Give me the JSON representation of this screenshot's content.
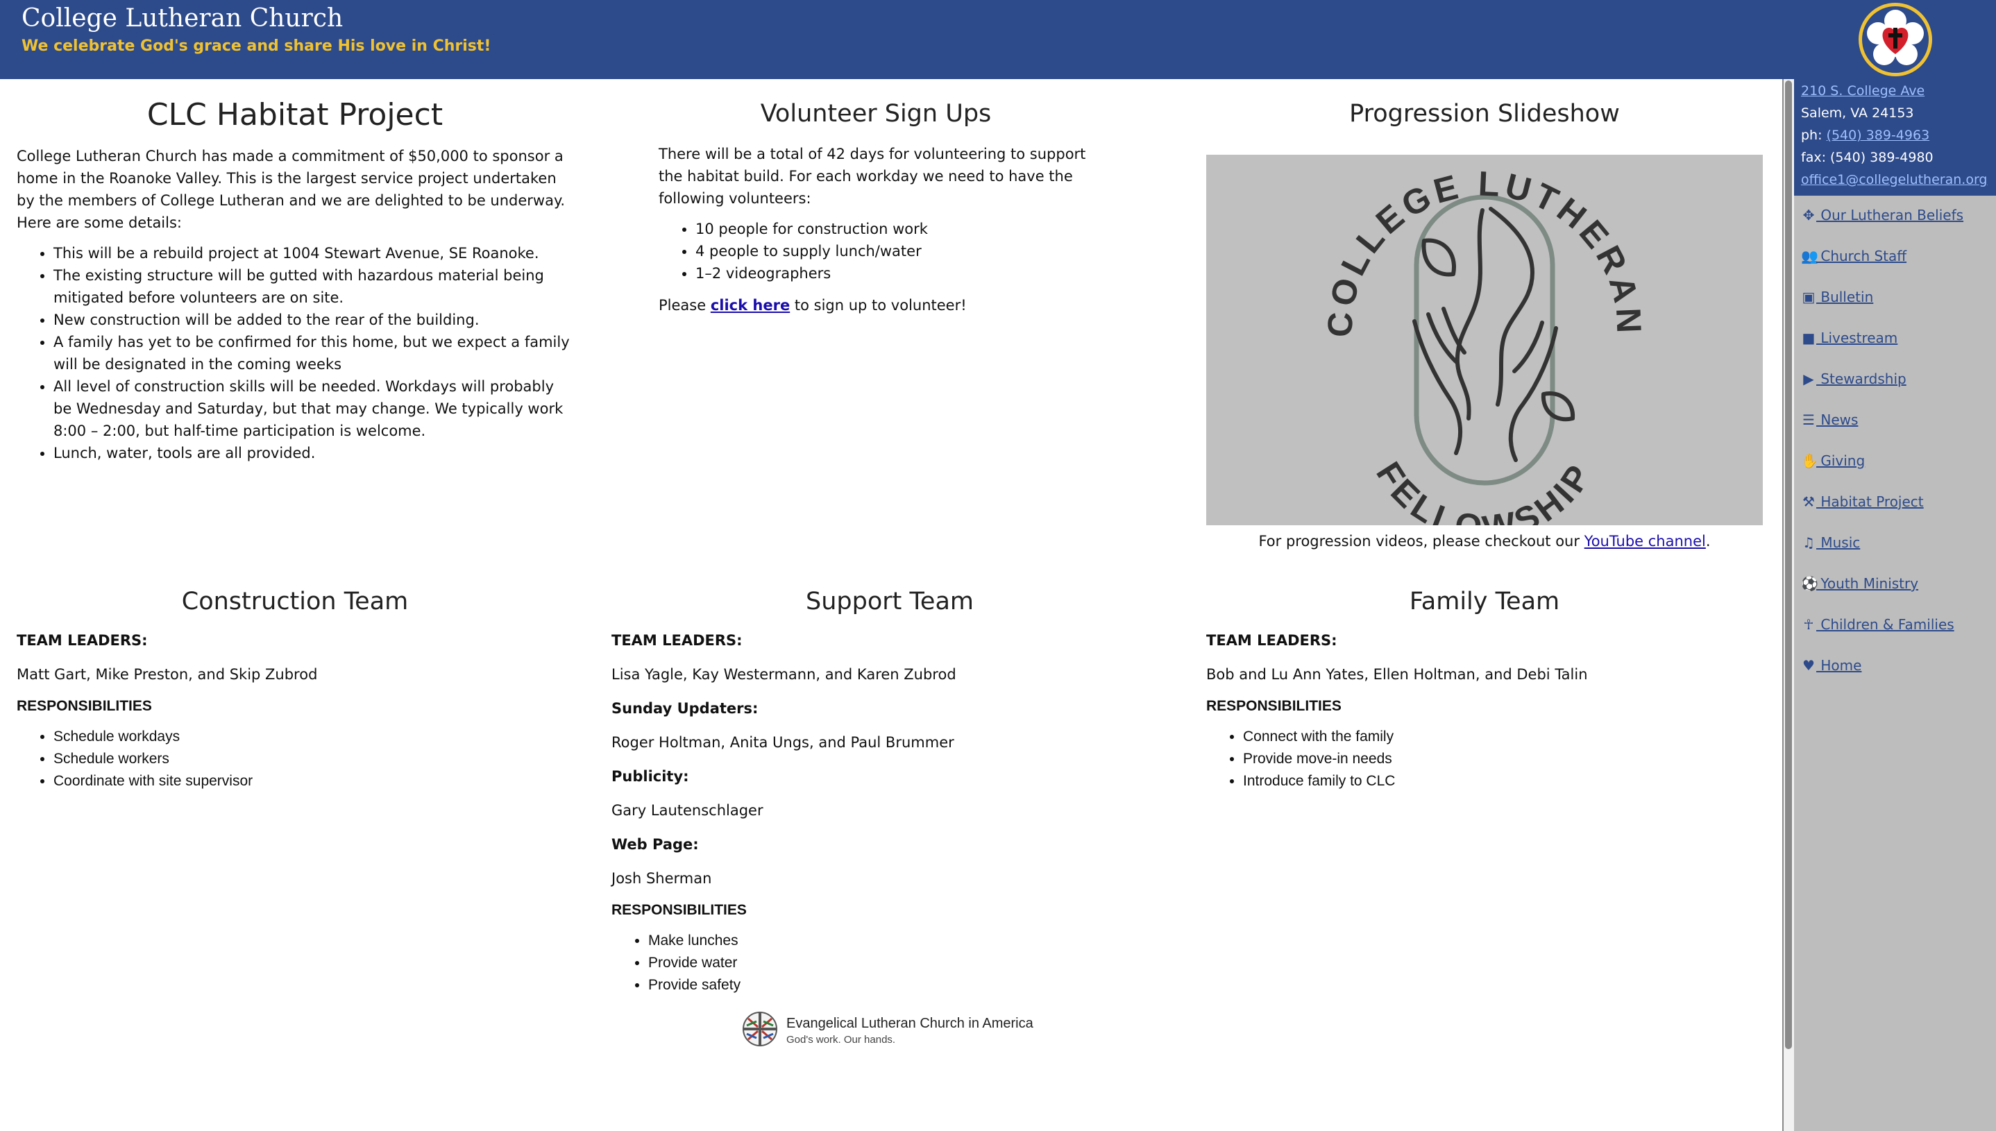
{
  "header": {
    "title": "College Lutheran Church",
    "tagline": "We celebrate God's grace and share His love in Christ!"
  },
  "habitat": {
    "heading": "CLC Habitat Project",
    "intro": "College Lutheran Church has made a commitment of $50,000 to sponsor a home in the Roanoke Valley. This is the largest service project undertaken by the members of College Lutheran and we are delighted to be underway.",
    "details_lead": "Here are some details:",
    "bullets": [
      "This will be a rebuild project at 1004 Stewart Avenue, SE Roanoke.",
      "The existing structure will be gutted with hazardous material being mitigated before volunteers are on site.",
      "New construction will be added to the rear of the building.",
      "A family has yet to be confirmed for this home, but we expect a family will be designated in the coming weeks",
      "All level of construction skills will be needed. Workdays will probably be Wednesday and Saturday, but that may change. We typically work 8:00 – 2:00, but half-time participation is welcome.",
      "Lunch, water, tools are all provided."
    ]
  },
  "volunteer": {
    "heading": "Volunteer Sign Ups",
    "intro": "There will be a total of 42 days for volunteering to support the habitat build. For each workday we need to have the following volunteers:",
    "bullets": [
      "10 people for construction work",
      "4 people to supply lunch/water",
      "1–2 videographers"
    ],
    "cta_pre": "Please ",
    "cta_link": "click here",
    "cta_post": " to sign up to volunteer!"
  },
  "slideshow": {
    "heading": "Progression Slideshow",
    "logo_top": "COLLEGE LUTHERAN",
    "logo_bottom": "FELLOWSHIP",
    "caption_pre": "For progression videos, please checkout our ",
    "caption_link": "YouTube channel",
    "caption_post": "."
  },
  "construction": {
    "heading": "Construction Team",
    "leaders_label": "TEAM LEADERS:",
    "leaders": "Matt Gart, Mike Preston, and Skip Zubrod",
    "resp_label": "RESPONSIBILITIES",
    "resp": [
      "Schedule workdays",
      "Schedule workers",
      "Coordinate with site supervisor"
    ]
  },
  "support": {
    "heading": "Support Team",
    "leaders_label": "TEAM LEADERS:",
    "leaders": "Lisa Yagle, Kay Westermann, and Karen Zubrod",
    "updaters_label": "Sunday Updaters:",
    "updaters": "Roger Holtman, Anita Ungs, and Paul Brummer",
    "publicity_label": "Publicity:",
    "publicity": "Gary Lautenschlager",
    "webpage_label": "Web Page:",
    "webpage": "Josh Sherman",
    "resp_label": "RESPONSIBILITIES",
    "resp": [
      "Make lunches",
      "Provide water",
      "Provide safety"
    ]
  },
  "family": {
    "heading": "Family Team",
    "leaders_label": "TEAM LEADERS:",
    "leaders": "Bob and Lu Ann Yates, Ellen Holtman, and Debi Talin",
    "resp_label": "RESPONSIBILITIES",
    "resp": [
      "Connect with the family",
      "Provide move-in needs",
      "Introduce family to CLC"
    ]
  },
  "footer": {
    "org": "Evangelical Lutheran Church in America",
    "slogan": "God's work. Our hands."
  },
  "sidebar": {
    "address": "210 S. College Ave",
    "city": "Salem, VA 24153",
    "phone_label": "ph: ",
    "phone": "(540) 389-4963",
    "fax": "fax: (540) 389-4980",
    "email": "office1@collegelutheran.org",
    "nav": [
      {
        "label": " Our Lutheran Beliefs",
        "icon": "arrows-icon"
      },
      {
        "label": " Church Staff",
        "icon": "users-icon"
      },
      {
        "label": " Bulletin",
        "icon": "book-icon"
      },
      {
        "label": " Livestream",
        "icon": "video-icon"
      },
      {
        "label": " Stewardship",
        "icon": "step-forward-icon"
      },
      {
        "label": " News",
        "icon": "newspaper-icon"
      },
      {
        "label": " Giving",
        "icon": "handshake-icon"
      },
      {
        "label": " Habitat Project",
        "icon": "hammer-icon"
      },
      {
        "label": " Music",
        "icon": "music-icon"
      },
      {
        "label": " Youth Ministry",
        "icon": "soccer-ball-icon"
      },
      {
        "label": " Children & Families",
        "icon": "child-icon"
      },
      {
        "label": " Home",
        "icon": "heart-icon"
      }
    ]
  },
  "colors": {
    "header_bg": "#2d4a8a",
    "tagline": "#f0c232",
    "sidebar_bg": "#bdbdbd",
    "slide_bg": "#c0c0c0"
  }
}
